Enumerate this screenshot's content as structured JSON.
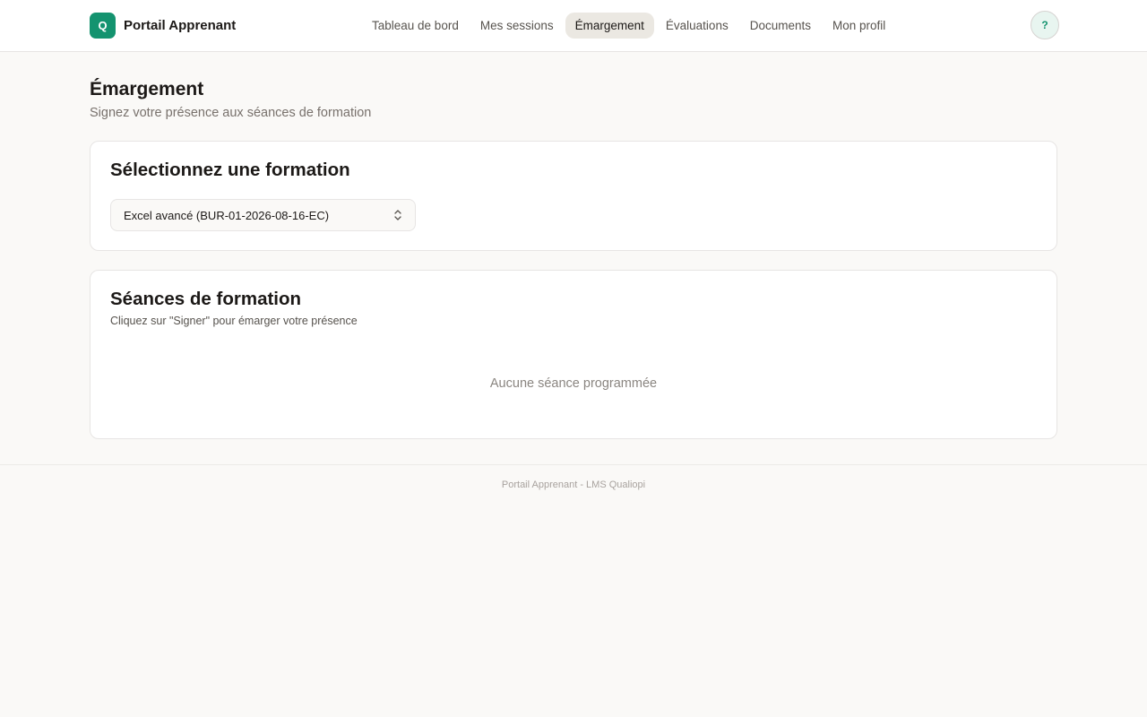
{
  "header": {
    "logo_letter": "Q",
    "app_name": "Portail Apprenant",
    "nav": [
      {
        "label": "Tableau de bord"
      },
      {
        "label": "Mes sessions"
      },
      {
        "label": "Émargement"
      },
      {
        "label": "Évaluations"
      },
      {
        "label": "Documents"
      },
      {
        "label": "Mon profil"
      }
    ],
    "active_nav": "Émargement",
    "help_label": "?"
  },
  "page": {
    "title": "Émargement",
    "subtitle": "Signez votre présence aux séances de formation"
  },
  "formation_card": {
    "title": "Sélectionnez une formation",
    "selected_formation": "Excel avancé (BUR-01-2026-08-16-EC)",
    "select_icon": "chevron-up-down-icon"
  },
  "sessions_card": {
    "title": "Séances de formation",
    "description": "Cliquez sur \"Signer\" pour émarger votre présence",
    "empty_message": "Aucune séance programmée"
  },
  "footer": {
    "text": "Portail Apprenant - LMS Qualiopi"
  },
  "colors": {
    "brand": "#14936f",
    "background": "#faf9f7",
    "active_nav_bg": "#ebe8e2"
  }
}
